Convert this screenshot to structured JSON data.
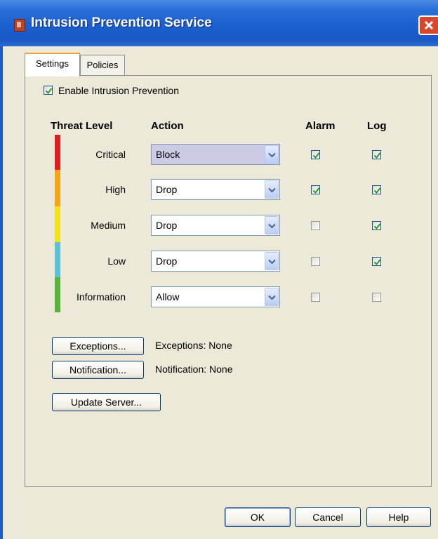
{
  "window": {
    "title": "Intrusion Prevention Service"
  },
  "tabs": [
    {
      "label": "Settings",
      "active": true
    },
    {
      "label": "Policies",
      "active": false
    }
  ],
  "enable": {
    "label": "Enable Intrusion Prevention",
    "checked": true
  },
  "headers": {
    "threat_level": "Threat Level",
    "action": "Action",
    "alarm": "Alarm",
    "log": "Log"
  },
  "rows": [
    {
      "level": "Critical",
      "color": "#e02020",
      "action": "Block",
      "alarm": true,
      "log": true
    },
    {
      "level": "High",
      "color": "#f3a41b",
      "action": "Drop",
      "alarm": true,
      "log": true
    },
    {
      "level": "Medium",
      "color": "#f1e21d",
      "action": "Drop",
      "alarm": false,
      "log": true
    },
    {
      "level": "Low",
      "color": "#5cc0d6",
      "action": "Drop",
      "alarm": false,
      "log": true
    },
    {
      "level": "Information",
      "color": "#58b43a",
      "action": "Allow",
      "alarm": false,
      "log": false
    }
  ],
  "exceptions": {
    "button": "Exceptions...",
    "status": "Exceptions: None"
  },
  "notification": {
    "button": "Notification...",
    "status": "Notification: None"
  },
  "update_server": {
    "button": "Update Server..."
  },
  "footer": {
    "ok": "OK",
    "cancel": "Cancel",
    "help": "Help"
  }
}
